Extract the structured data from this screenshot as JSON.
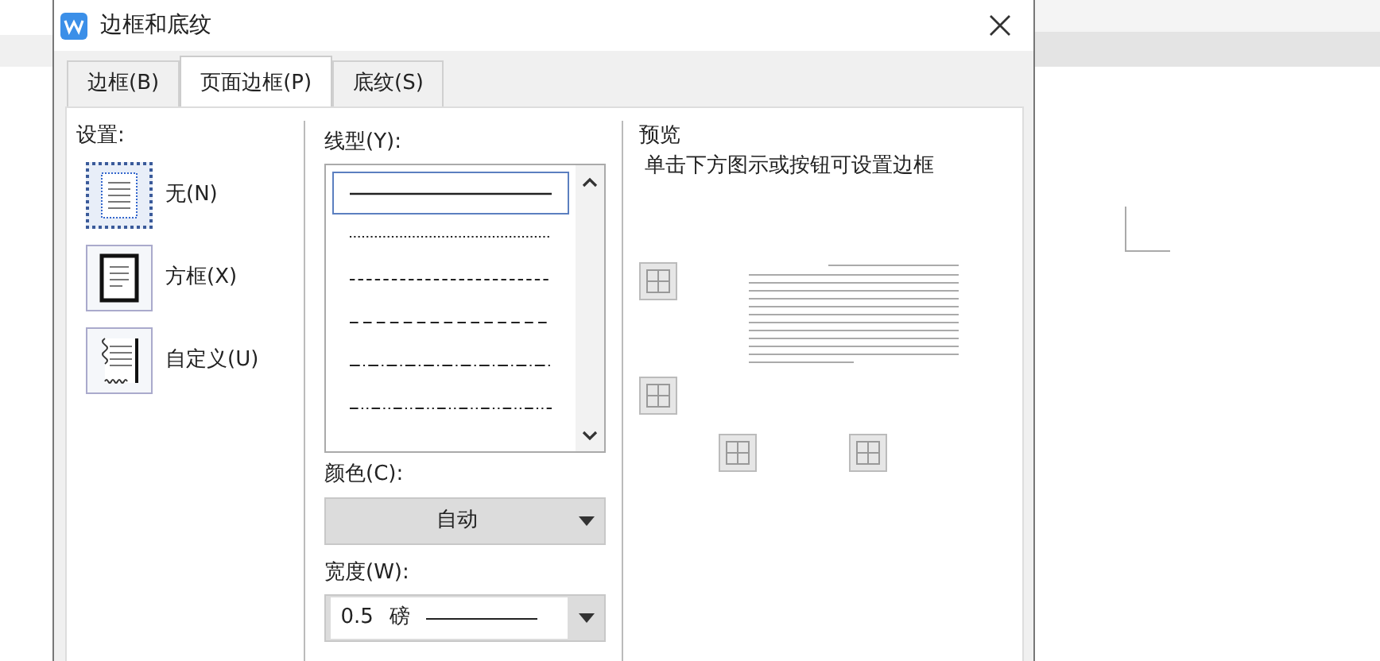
{
  "window": {
    "title": "边框和底纹"
  },
  "tabs": [
    {
      "label": "边框(B)",
      "selected": false
    },
    {
      "label": "页面边框(P)",
      "selected": true
    },
    {
      "label": "底纹(S)",
      "selected": false
    }
  ],
  "settings": {
    "label": "设置:",
    "items": [
      {
        "label": "无(N)",
        "kind": "none",
        "selected": true
      },
      {
        "label": "方框(X)",
        "kind": "box",
        "selected": false
      },
      {
        "label": "自定义(U)",
        "kind": "custom",
        "selected": false
      }
    ]
  },
  "line_style": {
    "label": "线型(Y):",
    "items": [
      {
        "kind": "solid",
        "selected": true
      },
      {
        "kind": "dotted",
        "selected": false
      },
      {
        "kind": "dashed",
        "selected": false
      },
      {
        "kind": "long-dash",
        "selected": false
      },
      {
        "kind": "dash-dot",
        "selected": false
      },
      {
        "kind": "dash-dot-dot",
        "selected": false
      }
    ]
  },
  "color": {
    "label": "颜色(C):",
    "value": "自动"
  },
  "width": {
    "label": "宽度(W):",
    "value": "0.5",
    "unit": "磅"
  },
  "preview": {
    "label": "预览",
    "hint": "单击下方图示或按钮可设置边框"
  }
}
